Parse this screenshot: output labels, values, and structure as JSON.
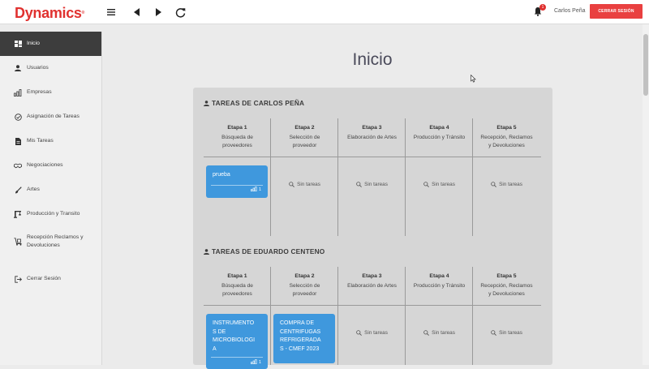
{
  "app": {
    "logo": "Dynamics",
    "logo_mark": "®"
  },
  "toolbar": {
    "menu_icon": "menu-icon",
    "back_icon": "back-icon",
    "forward_icon": "forward-icon",
    "reload_icon": "reload-icon"
  },
  "header": {
    "notification_count": "1",
    "user_name": "Carlos Peña",
    "logout_label": "CERRAR SESIÓN"
  },
  "sidebar": {
    "items": [
      {
        "label": "Inicio",
        "icon": "dashboard-icon",
        "active": true
      },
      {
        "label": "Usuarios",
        "icon": "user-icon"
      },
      {
        "label": "Empresas",
        "icon": "chart-icon"
      },
      {
        "label": "Asignación de Tareas",
        "icon": "check-circle-icon"
      },
      {
        "label": "Mis Tareas",
        "icon": "document-icon"
      },
      {
        "label": "Negociaciones",
        "icon": "handshake-icon"
      },
      {
        "label": "Artes",
        "icon": "brush-icon"
      },
      {
        "label": "Producción y Transito",
        "icon": "crane-icon"
      },
      {
        "label_line1": "Recepción Reclamos y",
        "label_line2": "Devoluciones",
        "icon": "dolly-icon"
      },
      {
        "label": "Cerrar Sesión",
        "icon": "logout-icon"
      }
    ]
  },
  "main": {
    "title": "Inicio",
    "sections": [
      {
        "title": "TAREAS DE CARLOS PEÑA",
        "stages": [
          {
            "num": "Etapa 1",
            "name_line1": "Búsqueda de",
            "name_line2": "proveedores"
          },
          {
            "num": "Etapa 2",
            "name_line1": "Selección de",
            "name_line2": "proveedor"
          },
          {
            "num": "Etapa 3",
            "name_line1": "Elaboración de Artes",
            "name_line2": ""
          },
          {
            "num": "Etapa 4",
            "name_line1": "Producción y Tránsito",
            "name_line2": ""
          },
          {
            "num": "Etapa 5",
            "name_line1": "Recepción, Reclamos",
            "name_line2": "y Devoluciones"
          }
        ],
        "tasks": [
          {
            "name": "prueba",
            "count": "1"
          }
        ],
        "empty_label": "Sin tareas"
      },
      {
        "title": "TAREAS DE EDUARDO CENTENO",
        "stages": [
          {
            "num": "Etapa 1",
            "name_line1": "Búsqueda de",
            "name_line2": "proveedores"
          },
          {
            "num": "Etapa 2",
            "name_line1": "Selección de",
            "name_line2": "proveedor"
          },
          {
            "num": "Etapa 3",
            "name_line1": "Elaboración de Artes",
            "name_line2": ""
          },
          {
            "num": "Etapa 4",
            "name_line1": "Producción y Tránsito",
            "name_line2": ""
          },
          {
            "num": "Etapa 5",
            "name_line1": "Recepción, Reclamos",
            "name_line2": "y Devoluciones"
          }
        ],
        "tasks": [
          {
            "name_lines": [
              "INSTRUMENTO",
              "S DE",
              "MICROBIOLOGI",
              "A"
            ],
            "count": "1"
          },
          {
            "name_lines": [
              "COMPRA DE",
              "CENTRIFUGAS",
              "REFRIGERADA",
              "S - CMEF 2023"
            ]
          }
        ],
        "empty_label": "Sin tareas"
      }
    ]
  },
  "colors": {
    "accent": "#e0312f",
    "task": "#3f98dd",
    "sidebar_active": "#3d3d3d"
  }
}
